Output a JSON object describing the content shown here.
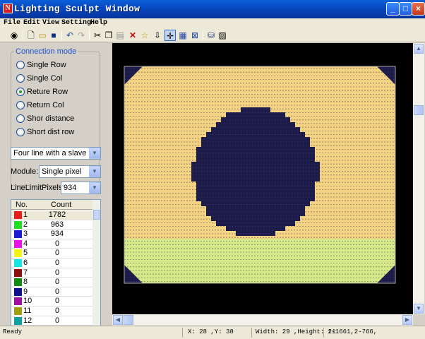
{
  "window": {
    "title": "Lighting Sculpt Window",
    "icon_letter": "N"
  },
  "menu": [
    "File",
    "Edit",
    "View",
    "Setting",
    "Help"
  ],
  "toolbar": {
    "buttons": [
      "connect-icon",
      "new-file-icon",
      "open-folder-icon",
      "save-icon",
      "undo-icon",
      "redo-icon",
      "cut-icon",
      "copy-icon",
      "paste-icon",
      "delete-icon",
      "lasso-icon",
      "place-pointer-icon",
      "crosshair-icon",
      "grid-icon",
      "clear-grid-icon",
      "export-icon",
      "picture-icon"
    ]
  },
  "connection_mode": {
    "title": "Connection mode",
    "options": [
      "Single Row",
      "Single Col",
      "Reture Row",
      "Return Col",
      "Shor distance",
      "Short dist row"
    ],
    "selected_index": 2
  },
  "line_select": {
    "value": "Four line with a slave"
  },
  "module": {
    "label": "Module:",
    "value": "Single pixel"
  },
  "line_limit": {
    "label": "LineLimitPixels:",
    "value": "934"
  },
  "table": {
    "headers": [
      "No.",
      "Count"
    ],
    "rows": [
      {
        "no": "1",
        "count": "1782",
        "color": "#e61e1e"
      },
      {
        "no": "2",
        "count": "963",
        "color": "#22dd22"
      },
      {
        "no": "3",
        "count": "934",
        "color": "#1c1cd4"
      },
      {
        "no": "4",
        "count": "0",
        "color": "#e614e6"
      },
      {
        "no": "5",
        "count": "0",
        "color": "#f5f514"
      },
      {
        "no": "6",
        "count": "0",
        "color": "#14e6e6"
      },
      {
        "no": "7",
        "count": "0",
        "color": "#8b1010"
      },
      {
        "no": "8",
        "count": "0",
        "color": "#108b10"
      },
      {
        "no": "9",
        "count": "0",
        "color": "#10108b"
      },
      {
        "no": "10",
        "count": "0",
        "color": "#a010a0"
      },
      {
        "no": "11",
        "count": "0",
        "color": "#a0a010"
      },
      {
        "no": "12",
        "count": "0",
        "color": "#10a0a0"
      }
    ]
  },
  "status": {
    "ready": "Ready",
    "coords": "X: 28 ,Y: 38",
    "size": "Width: 29 ,Height: 21",
    "range": "1-1661,2-766,"
  },
  "colors": {
    "upper_fill": "#f3d281",
    "lower_fill": "#d7e888",
    "circle": "#1c1b4a",
    "grid_dot": "#1c1b4a"
  }
}
